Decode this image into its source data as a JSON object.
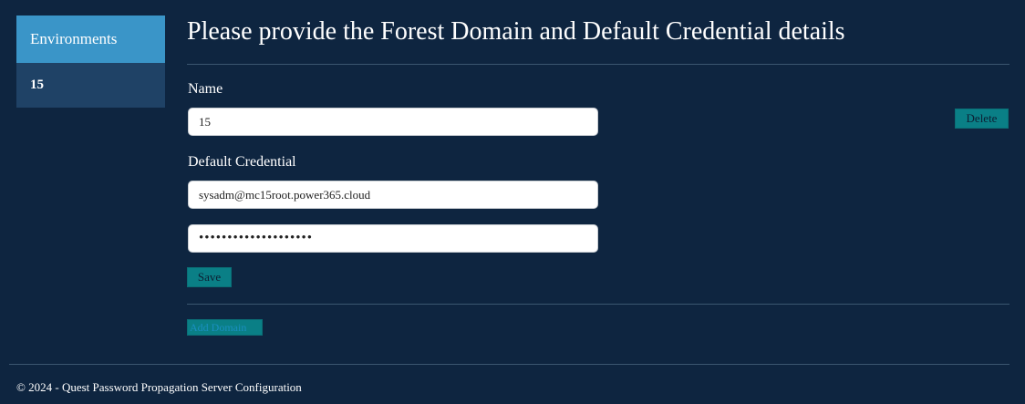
{
  "sidebar": {
    "header": "Environments",
    "items": [
      {
        "label": "15"
      }
    ]
  },
  "main": {
    "title": "Please provide the Forest Domain and Default Credential details",
    "name_label": "Name",
    "name_value": "15",
    "delete_label": "Delete",
    "credential_label": "Default Credential",
    "username_value": "sysadm@mc15root.power365.cloud",
    "password_mask": "••••••••••••••••••••",
    "save_label": "Save",
    "add_domain_label": "Add Domain"
  },
  "footer": {
    "text": "© 2024 - Quest Password Propagation Server Configuration"
  },
  "colors": {
    "background": "#0e2540",
    "sidebar_header": "#3a95c8",
    "sidebar_body": "#1f4266",
    "button": "#0a7f86"
  }
}
